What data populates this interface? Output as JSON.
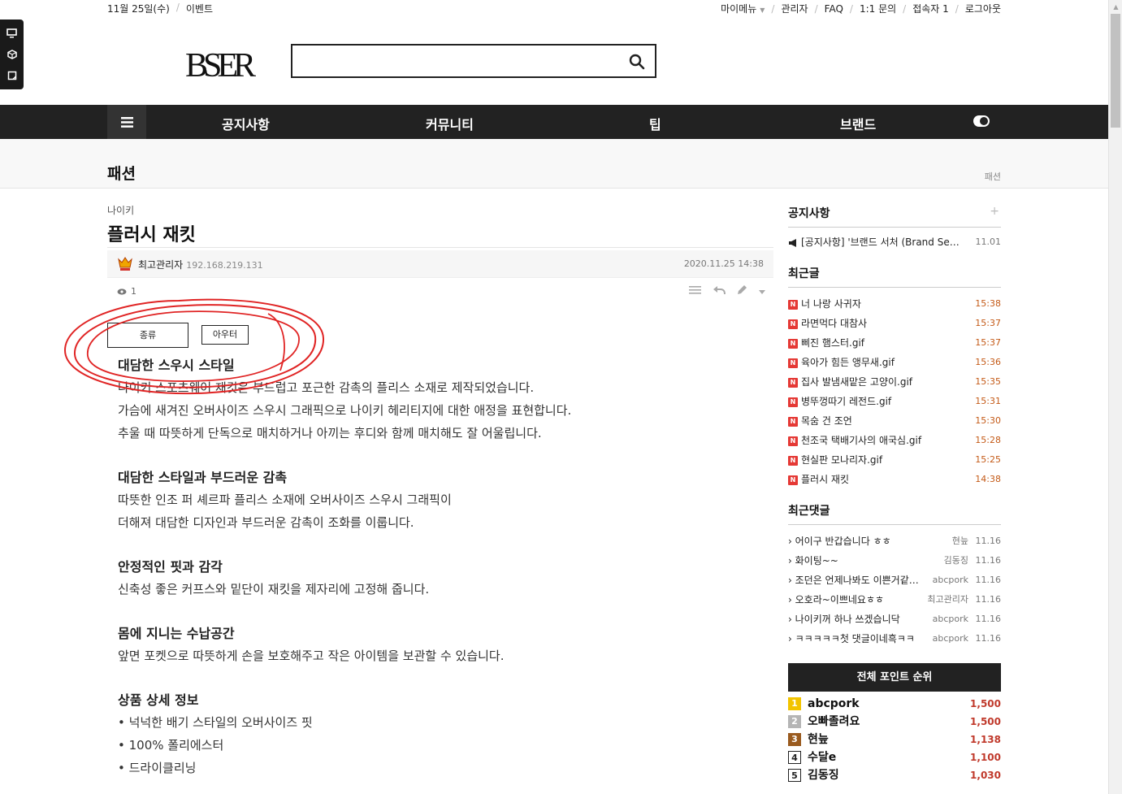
{
  "topbar": {
    "date": "11월 25일(수)",
    "event": "이벤트",
    "links": [
      "마이메뉴",
      "관리자",
      "FAQ",
      "1:1 문의",
      "접속자 1",
      "로그아웃"
    ]
  },
  "logo": {
    "text": "BSER"
  },
  "search": {
    "value": "",
    "placeholder": ""
  },
  "nav": {
    "items": [
      "공지사항",
      "커뮤니티",
      "팁",
      "브랜드"
    ]
  },
  "page": {
    "title": "패션",
    "breadcrumb": "패션"
  },
  "article": {
    "category": "나이키",
    "title": "플러시 재킷",
    "author": "최고관리자",
    "ip": "192.168.219.131",
    "date": "2020.11.25 14:38",
    "views": "1",
    "tags": [
      "종류",
      "아우터"
    ],
    "sections": [
      {
        "heading": "대담한 스우시 스타일",
        "lines": [
          "나이키 스포츠웨어 재킷은 부드럽고 포근한 감촉의 플리스 소재로 제작되었습니다.",
          "가슴에 새겨진 오버사이즈 스우시 그래픽으로 나이키 헤리티지에 대한 애정을 표현합니다.",
          "추울 때 따뜻하게 단독으로 매치하거나 아끼는 후디와 함께 매치해도 잘 어울립니다."
        ]
      },
      {
        "heading": "대담한 스타일과 부드러운 감촉",
        "lines": [
          "따뜻한 인조 퍼 셰르파 플리스 소재에 오버사이즈 스우시 그래픽이",
          "더해져 대담한 디자인과 부드러운 감촉이 조화를 이룹니다."
        ]
      },
      {
        "heading": "안정적인 핏과 감각",
        "lines": [
          "신축성 좋은 커프스와 밑단이 재킷을 제자리에 고정해 줍니다."
        ]
      },
      {
        "heading": "몸에 지니는 수납공간",
        "lines": [
          "앞면 포켓으로 따뜻하게 손을 보호해주고 작은 아이템을 보관할 수 있습니다."
        ]
      },
      {
        "heading": "상품 상세 정보",
        "lines": [
          "• 넉넉한 배기 스타일의 오버사이즈 핏",
          "• 100% 폴리에스터",
          "• 드라이클리닝"
        ]
      }
    ]
  },
  "sidebar": {
    "notice": {
      "title": "공지사항",
      "items": [
        {
          "text": "[공지사항] '브랜드 서처 (Brand Se…",
          "time": "11.01"
        }
      ]
    },
    "recent_posts": {
      "title": "최근글",
      "items": [
        {
          "text": "너 나랑 사귀자",
          "time": "15:38"
        },
        {
          "text": "라면먹다 대참사",
          "time": "15:37"
        },
        {
          "text": "삐진 햄스터.gif",
          "time": "15:37"
        },
        {
          "text": "육아가 힘든 앵무새.gif",
          "time": "15:36"
        },
        {
          "text": "집사 발냄새맡은 고양이.gif",
          "time": "15:35"
        },
        {
          "text": "병뚜껑따기 레전드.gif",
          "time": "15:31"
        },
        {
          "text": "목숨 건 조언",
          "time": "15:30"
        },
        {
          "text": "천조국 택배기사의 애국심.gif",
          "time": "15:28"
        },
        {
          "text": "현실판 모나리자.gif",
          "time": "15:25"
        },
        {
          "text": "플러시 재킷",
          "time": "14:38"
        }
      ]
    },
    "recent_comments": {
      "title": "최근댓글",
      "items": [
        {
          "text": "어이구 반갑습니다 ㅎㅎ",
          "nick": "현늪",
          "date": "11.16"
        },
        {
          "text": "화이팅~~",
          "nick": "김동징",
          "date": "11.16"
        },
        {
          "text": "조던은 언제나봐도 이쁜거같…",
          "nick": "abcpork",
          "date": "11.16"
        },
        {
          "text": "오호라~이쁘네요ㅎㅎ",
          "nick": "최고관리자",
          "date": "11.16"
        },
        {
          "text": "나이키꺼 하나 쓰겠습니닥",
          "nick": "abcpork",
          "date": "11.16"
        },
        {
          "text": "ㅋㅋㅋㅋㅋ첫 댓글이네흑ㅋㅋ",
          "nick": "abcpork",
          "date": "11.16"
        }
      ]
    },
    "ranking": {
      "title": "전체 포인트 순위",
      "items": [
        {
          "rank": "1",
          "name": "abcpork",
          "points": "1,500",
          "color": "#f2c400"
        },
        {
          "rank": "2",
          "name": "오빠졸려요",
          "points": "1,500",
          "color": "#b5b5b5"
        },
        {
          "rank": "3",
          "name": "현늪",
          "points": "1,138",
          "color": "#9a5b1f"
        },
        {
          "rank": "4",
          "name": "수달e",
          "points": "1,100",
          "color": "#ffffff"
        },
        {
          "rank": "5",
          "name": "김동징",
          "points": "1,030",
          "color": "#ffffff"
        }
      ]
    }
  }
}
